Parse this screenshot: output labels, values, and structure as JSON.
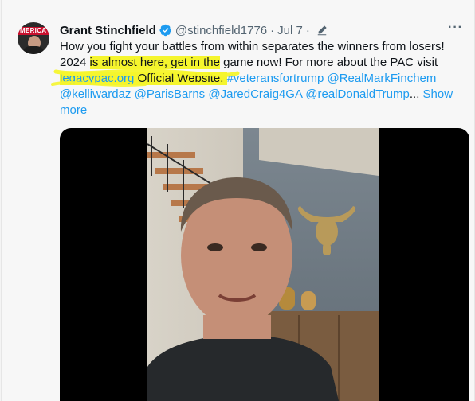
{
  "tweet": {
    "author_name": "Grant Stinchfield",
    "handle": "@stinchfield1776",
    "separator": "·",
    "date": "Jul 7",
    "separator2": "·",
    "more_label": "···",
    "avatar_text": "MERICA",
    "body_lines": {
      "line1": "How you fight your battles from within separates the winners from losers!",
      "line2_a": "2024 ",
      "line2_b": "is almost here, get in the",
      "line2_c": " game now! For more about the PAC visit",
      "line3_link": "legacypac.org",
      "line3_text": " Official Website. ",
      "line3_tag": "#veteransfortrump",
      "line3_space": "  ",
      "line3_mention": "@RealMarkFinchem",
      "line4_mentions": "@kelliwardaz @ParisBarns @JaredCraig4GA @realDonaldTrump",
      "line4_ellipsis": "... ",
      "show_more": "Show",
      "show_more_2": "more"
    }
  },
  "colors": {
    "link": "#1d9bf0",
    "highlight": "#f5f52d",
    "verified": "#1d9bf0",
    "secondary_text": "#536471"
  }
}
